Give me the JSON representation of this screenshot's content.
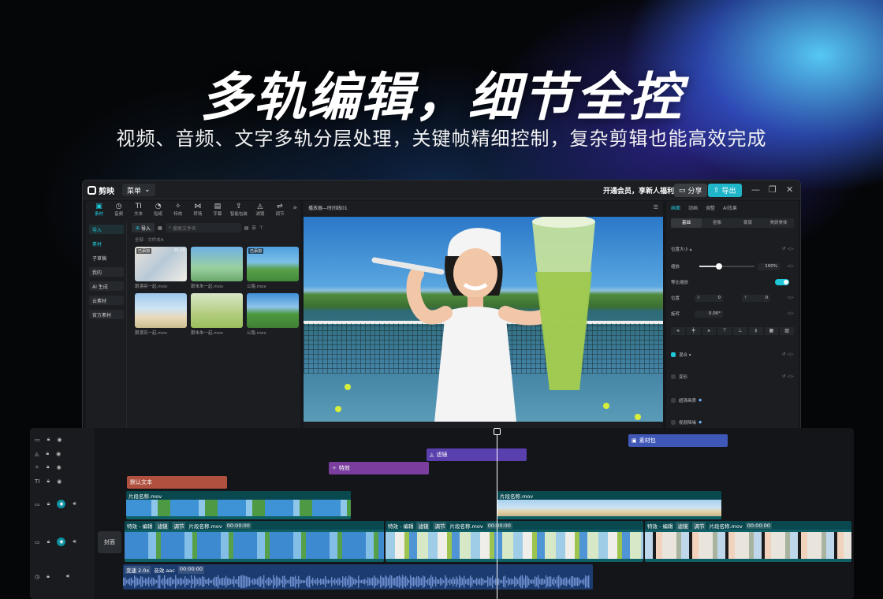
{
  "hero": {
    "title": "多轨编辑，细节全控",
    "subtitle": "视频、音频、文字多轨分层处理，关键帧精细控制，复杂剪辑也能高效完成"
  },
  "window": {
    "app_name": "剪映",
    "menu_label": "菜单",
    "promo": "开通会员，享新人福利",
    "share_label": "分享",
    "export_label": "导出",
    "controls": [
      "—",
      "❐",
      "✕"
    ]
  },
  "library": {
    "tabs": [
      {
        "label": "素材",
        "icon": "▣"
      },
      {
        "label": "音频",
        "icon": "◷"
      },
      {
        "label": "文本",
        "icon": "TI"
      },
      {
        "label": "贴纸",
        "icon": "◔"
      },
      {
        "label": "特效",
        "icon": "✧"
      },
      {
        "label": "转场",
        "icon": "⋈"
      },
      {
        "label": "字幕",
        "icon": "▤"
      },
      {
        "label": "智能包装",
        "icon": "⇪"
      },
      {
        "label": "滤镜",
        "icon": "◬"
      },
      {
        "label": "调节",
        "icon": "⇌"
      }
    ],
    "more": "»",
    "side": [
      "导入",
      "素材",
      "子草稿",
      "我的",
      "AI 生成",
      "云素材",
      "官方素材"
    ],
    "import_btn": "导入",
    "search_placeholder": "搜索文件名",
    "breadcrumb": "全部 · 文件夹A",
    "thumbs": [
      {
        "caption": "跟漂亮一起.mov",
        "tag": "已添加",
        "dur": "01:20"
      },
      {
        "caption": "跟朱朱一起.mov",
        "tag": "",
        "dur": ""
      },
      {
        "caption": "公路.mov",
        "tag": "已添加",
        "dur": ""
      },
      {
        "caption": "跟漂亮一起.mov",
        "tag": "",
        "dur": ""
      },
      {
        "caption": "跟朱朱一起.mov",
        "tag": "",
        "dur": ""
      },
      {
        "caption": "公路.mov",
        "tag": "",
        "dur": ""
      }
    ]
  },
  "player": {
    "title": "播放器—时间线01"
  },
  "props": {
    "tabs": [
      "画面",
      "动画",
      "调整",
      "AI效果"
    ],
    "subtabs": [
      "基础",
      "抠像",
      "蒙版",
      "美颜美体"
    ],
    "section_pos": "位置大小 ▴",
    "scale_label": "缩放",
    "scale_value": "100%",
    "scale_fraction": 0.35,
    "ratio_label": "等比缩放",
    "position_label": "位置",
    "x_label": "X",
    "x_value": "0",
    "y_label": "Y",
    "y_value": "0",
    "rotate_label": "旋转",
    "rotate_value": "0.00°",
    "align_icons": [
      "⫷",
      "╪",
      "⫸",
      "⊤",
      "⊥",
      "⫫",
      "▦",
      "▥"
    ],
    "blend_label": "混合 ▾",
    "transform_label": "变形",
    "hq_label": "超清画质",
    "denoise_label": "视频降噪"
  },
  "timeline": {
    "cover_label": "封面",
    "clips": {
      "material_pack": "素材包",
      "filter": "滤镜",
      "effect": "特效",
      "default_text": "默认文本",
      "segment1": "片段名称.mov",
      "segment2": "片段名称.mov"
    },
    "main_clip": {
      "fx": "特效 - 编辑",
      "filter": "滤镜",
      "adjust": "调节",
      "name": "片段名称.mov",
      "time": "00:00:00"
    },
    "audio": {
      "speed": "变速 2.0x",
      "name": "音效.aac",
      "time": "00:00:00"
    }
  }
}
